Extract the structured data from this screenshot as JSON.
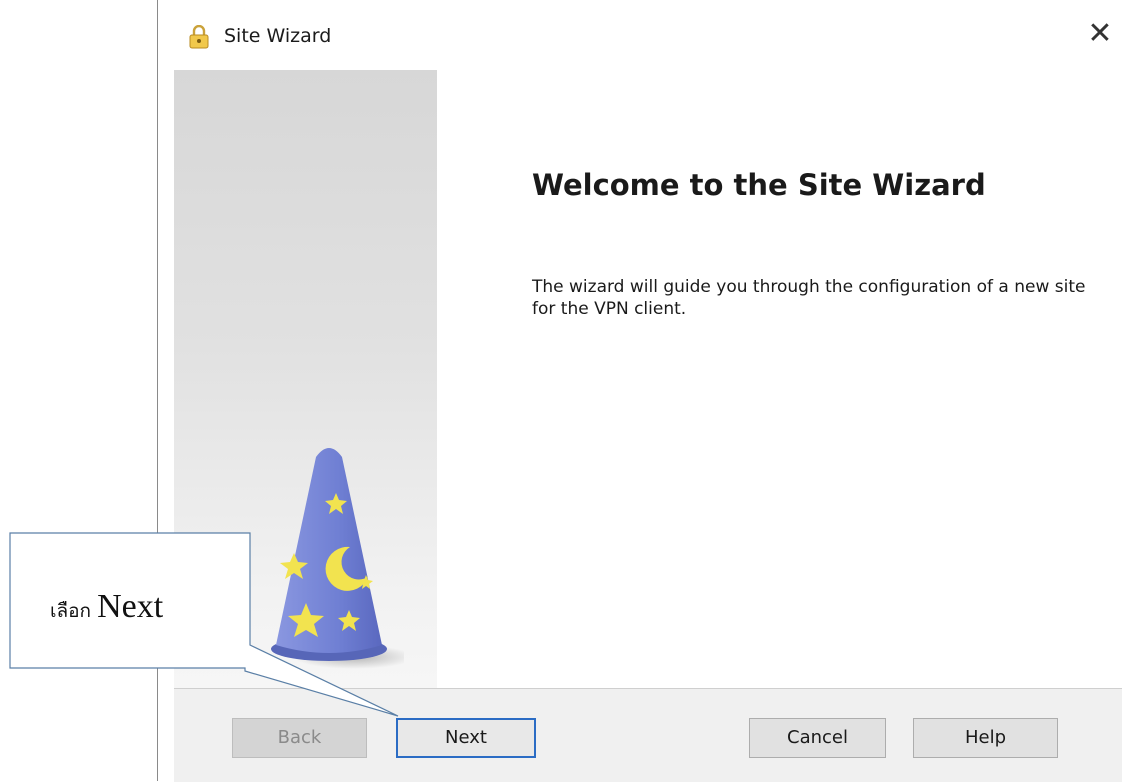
{
  "window": {
    "title": "Site Wizard",
    "close_icon": "close-icon",
    "app_icon": "padlock-icon"
  },
  "main": {
    "heading": "Welcome to the Site Wizard",
    "description": "The wizard will guide you through the configuration of a new site for the VPN client."
  },
  "buttons": {
    "back": "Back",
    "next": "Next",
    "cancel": "Cancel",
    "help": "Help"
  },
  "annotation": {
    "thai": "เลือก",
    "english": "Next"
  },
  "colors": {
    "accent_focus": "#2b6cc4",
    "hat_blue": "#6f7fd3",
    "star_yellow": "#f2e34f"
  }
}
